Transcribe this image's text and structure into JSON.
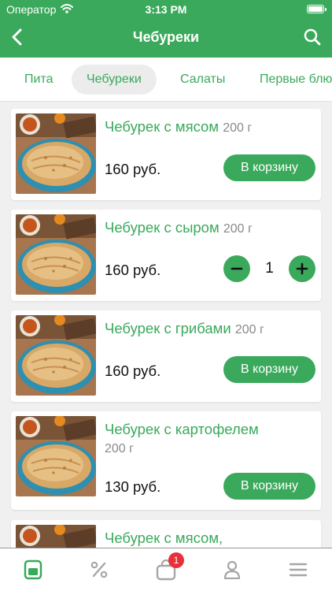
{
  "status_bar": {
    "carrier": "Оператор",
    "time": "3:13 PM"
  },
  "nav": {
    "title": "Чебуреки"
  },
  "tabs": [
    {
      "label": "Пита",
      "active": false
    },
    {
      "label": "Чебуреки",
      "active": true
    },
    {
      "label": "Салаты",
      "active": false
    },
    {
      "label": "Первые блюда",
      "active": false
    }
  ],
  "products": [
    {
      "name": "Чебурек с мясом",
      "weight": "200 г",
      "price": "160 руб.",
      "button": "В корзину"
    },
    {
      "name": "Чебурек с сыром",
      "weight": "200 г",
      "price": "160 руб.",
      "quantity": "1"
    },
    {
      "name": "Чебурек с грибами",
      "weight": "200 г",
      "price": "160 руб.",
      "button": "В корзину"
    },
    {
      "name": "Чебурек с картофелем",
      "weight": "200 г",
      "price": "130 руб.",
      "button": "В корзину"
    },
    {
      "name": "Чебурек с мясом,"
    }
  ],
  "tabbar": {
    "cart_badge": "1"
  },
  "colors": {
    "accent": "#3aa95b",
    "badge": "#e8303a",
    "active_tab_bg": "#ececec"
  },
  "icons": [
    "wifi-icon",
    "battery-icon",
    "back-arrow-icon",
    "search-icon",
    "menu-card-icon",
    "percent-icon",
    "shopping-bag-icon",
    "user-icon",
    "hamburger-menu-icon",
    "minus-icon",
    "plus-icon"
  ]
}
